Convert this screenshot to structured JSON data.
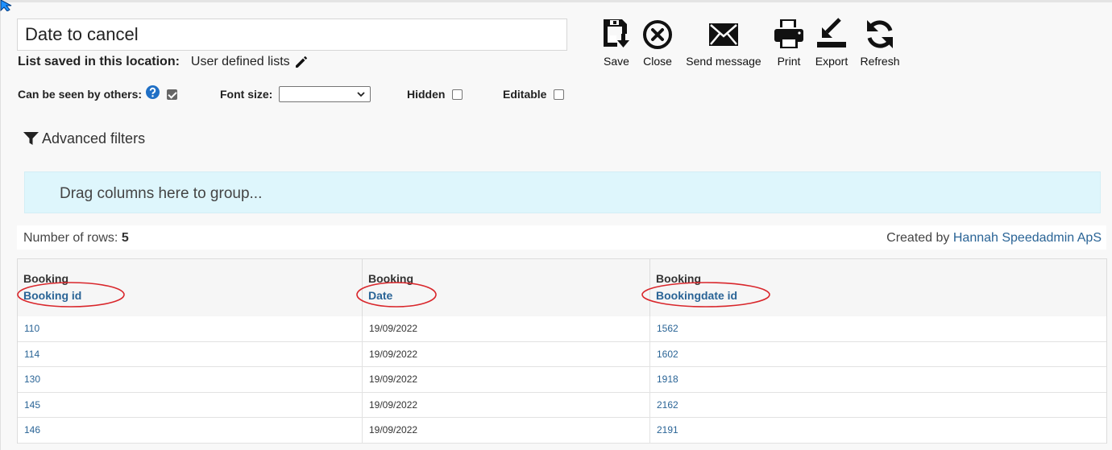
{
  "list": {
    "title": "Date to cancel",
    "saved_label": "List saved in this location:",
    "saved_value": "User defined lists"
  },
  "toolbar": {
    "save": "Save",
    "close": "Close",
    "send_message": "Send message",
    "print": "Print",
    "export": "Export",
    "refresh": "Refresh"
  },
  "options": {
    "seen_by_others_label": "Can be seen by others:",
    "seen_by_others_checked": true,
    "font_size_label": "Font size:",
    "font_size_value": "",
    "hidden_label": "Hidden",
    "hidden_checked": false,
    "editable_label": "Editable",
    "editable_checked": false
  },
  "filters": {
    "advanced_label": "Advanced filters"
  },
  "group_zone": {
    "placeholder": "Drag columns here to group..."
  },
  "info": {
    "rows_label": "Number of rows:",
    "rows_count": "5",
    "created_by_label": "Created by",
    "created_by_name": "Hannah Speedadmin ApS"
  },
  "grid": {
    "columns": [
      {
        "group": "Booking",
        "name": "Booking id"
      },
      {
        "group": "Booking",
        "name": "Date"
      },
      {
        "group": "Booking",
        "name": "Bookingdate id"
      }
    ],
    "rows": [
      [
        "110",
        "19/09/2022",
        "1562"
      ],
      [
        "114",
        "19/09/2022",
        "1602"
      ],
      [
        "130",
        "19/09/2022",
        "1918"
      ],
      [
        "145",
        "19/09/2022",
        "2162"
      ],
      [
        "146",
        "19/09/2022",
        "2191"
      ]
    ]
  },
  "colors": {
    "link": "#2a6496",
    "group_zone_bg": "#def6fc",
    "annotation_ellipse": "#d9262b"
  }
}
